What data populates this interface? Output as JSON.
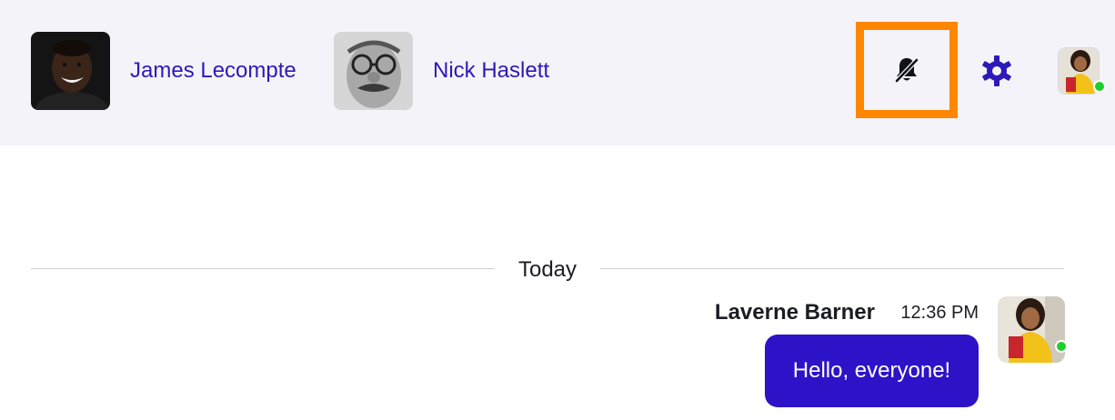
{
  "participants": [
    {
      "name": "James Lecompte",
      "avatar": "photo-avatar"
    },
    {
      "name": "Nick Haslett",
      "avatar": "photo-avatar"
    }
  ],
  "toolbar": {
    "mute_icon": "bell-slash-icon",
    "settings_icon": "gear-icon",
    "user_status": "online"
  },
  "chat": {
    "date_divider": "Today",
    "messages": [
      {
        "sender": "Laverne Barner",
        "time": "12:36 PM",
        "text": "Hello, everyone!",
        "sender_status": "online"
      }
    ]
  },
  "colors": {
    "accent": "#2d19b8",
    "bubble": "#2d13c7",
    "header_bg": "#f4f3f9",
    "highlight": "#ff8600",
    "online": "#1fcf2b"
  }
}
